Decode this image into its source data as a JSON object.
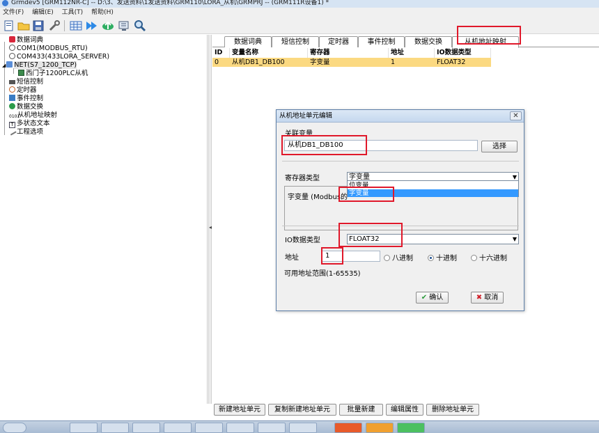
{
  "window": {
    "title": "Grmdev5 [GRM112NR-C] -- D:\\3、发送资料\\1发送资料\\GRM110\\LORA_从机\\GRMPRJ -- (GRM111R设备1) *"
  },
  "menu": {
    "items": [
      {
        "label": "文件(F)"
      },
      {
        "label": "编辑(E)"
      },
      {
        "label": "工具(T)"
      },
      {
        "label": "帮助(H)"
      }
    ]
  },
  "toolbar": {
    "icons": [
      "new-file-icon",
      "open-folder-icon",
      "save-icon",
      "wrench-icon",
      "config-grid-icon",
      "download-arrow-icon",
      "cloud-upload-icon",
      "monitor-icon",
      "search-icon"
    ]
  },
  "tree": {
    "items": [
      {
        "label": "数据词典",
        "icon": "book-icon"
      },
      {
        "label": "COM1(MODBUS_RTU)",
        "icon": "serial-icon"
      },
      {
        "label": "COM433(433LORA_SERVER)",
        "icon": "serial-icon"
      },
      {
        "label": "NET(S7_1200_TCP)",
        "icon": "network-icon"
      },
      {
        "label": "西门子1200PLC从机",
        "icon": "device-icon"
      },
      {
        "label": "短信控制",
        "icon": "sms-icon"
      },
      {
        "label": "定时器",
        "icon": "clock-icon"
      },
      {
        "label": "事件控制",
        "icon": "event-icon"
      },
      {
        "label": "数据交换",
        "icon": "exchange-icon"
      },
      {
        "label": "从机地址映射",
        "icon": "mapping-icon"
      },
      {
        "label": "多状态文本",
        "icon": "text-icon"
      },
      {
        "label": "工程选项",
        "icon": "options-icon"
      }
    ]
  },
  "tabs": [
    {
      "label": "数据词典"
    },
    {
      "label": "短信控制"
    },
    {
      "label": "定时器"
    },
    {
      "label": "事件控制"
    },
    {
      "label": "数据交换"
    },
    {
      "label": "从机地址映射"
    }
  ],
  "grid": {
    "columns": [
      "ID",
      "变量名称",
      "寄存器",
      "地址",
      "IO数据类型"
    ],
    "rows": [
      {
        "id": "0",
        "name": "从机DB1_DB100",
        "register": "字变量",
        "address": "1",
        "io_type": "FLOAT32"
      }
    ]
  },
  "bottom_buttons": [
    {
      "label": "新建地址单元"
    },
    {
      "label": "复制新建地址单元"
    },
    {
      "label": "批量新建"
    },
    {
      "label": "编辑属性"
    },
    {
      "label": "删除地址单元"
    }
  ],
  "dialog": {
    "title": "从机地址单元编辑",
    "close_label": "✕",
    "linked_var_label": "关联变量",
    "linked_var_value": "从机DB1_DB100",
    "select_button": "选择",
    "register_type_label": "寄存器类型",
    "register_type_value": "字变量",
    "register_options": [
      {
        "label": "位变量"
      },
      {
        "label": "字变量"
      }
    ],
    "description": "字变量 (Modbus的",
    "io_type_label": "IO数据类型",
    "io_type_value": "FLOAT32",
    "address_label": "地址",
    "address_value": "1",
    "radix_options": [
      {
        "label": "八进制",
        "checked": false
      },
      {
        "label": "十进制",
        "checked": true
      },
      {
        "label": "十六进制",
        "checked": false
      }
    ],
    "address_range": "可用地址范围(1-65535)",
    "ok_button": "确认",
    "cancel_button": "取消"
  },
  "colors": {
    "selected_row": "#fbd981",
    "highlight": "#3399ff",
    "annotation_red": "#e0182a",
    "dialog_bg": "#f0f0f0"
  }
}
